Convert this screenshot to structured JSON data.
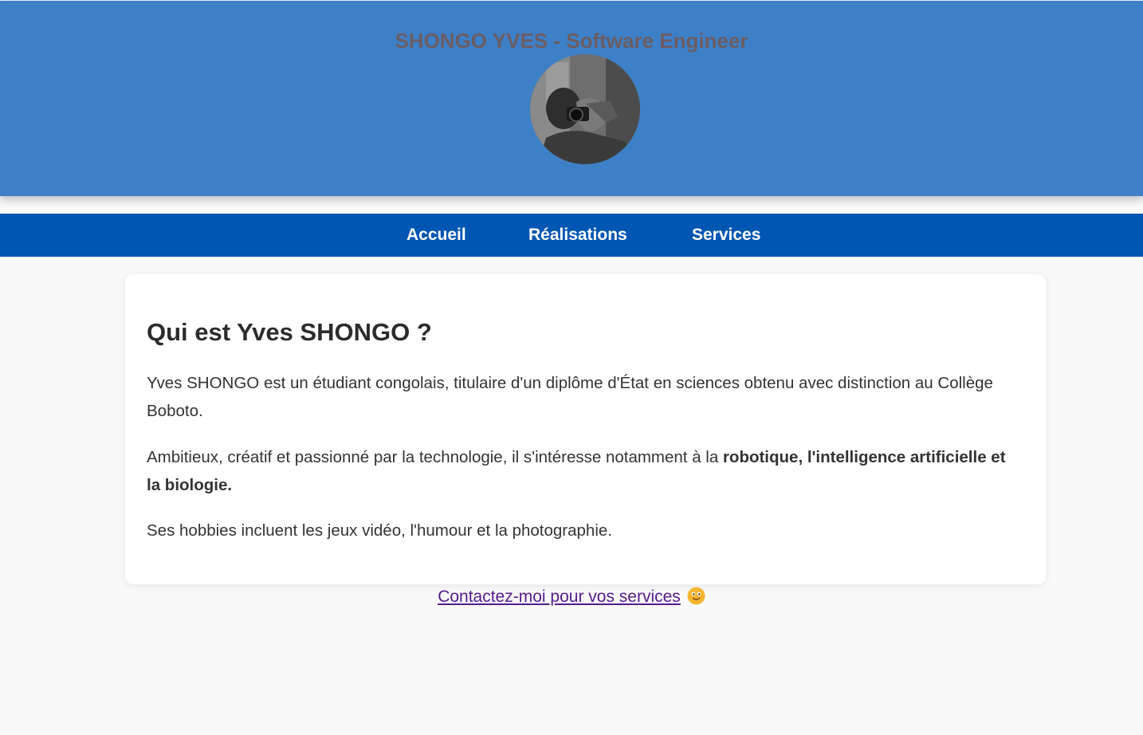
{
  "header": {
    "title": "SHONGO YVES - Software Engineer"
  },
  "nav": {
    "items": [
      "Accueil",
      "Réalisations",
      "Services"
    ]
  },
  "about": {
    "heading": "Qui est Yves SHONGO ?",
    "p1": "Yves SHONGO est un étudiant congolais, titulaire d'un diplôme d'État en sciences obtenu avec distinction au Collège Boboto.",
    "p2_normal": "Ambitieux, créatif et passionné par la technologie, il s'intéresse notamment à la ",
    "p2_bold": "robotique, l'intelligence artificielle et la biologie.",
    "p3": "Ses hobbies incluent les jeux vidéo, l'humour et la photographie."
  },
  "contact": {
    "link_text": "Contactez-moi pour vos services",
    "emoji_icon": "smiley-icon"
  },
  "colors": {
    "header_bg": "#3d80c7",
    "nav_bg": "#0056b3",
    "link": "#551a8b"
  }
}
